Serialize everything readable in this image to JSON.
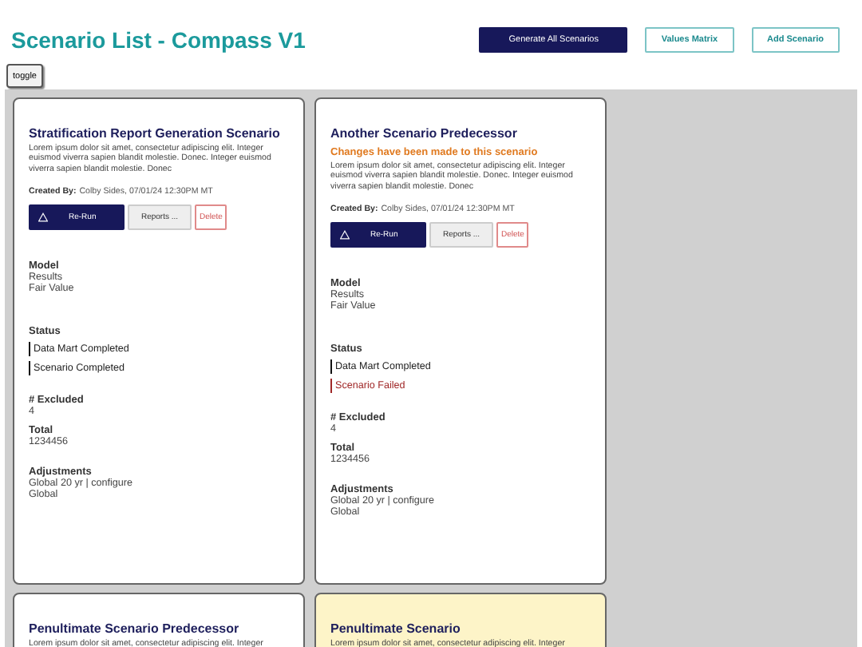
{
  "header": {
    "title": "Scenario List - Compass V1",
    "buttons": [
      {
        "label": "Generate All Scenarios",
        "kind": "primary"
      },
      {
        "label": "Values Matrix",
        "kind": "outline"
      },
      {
        "label": "Add Scenario",
        "kind": "outline"
      }
    ]
  },
  "toggle": "toggle",
  "cards": [
    {
      "title": "Stratification Report Generation Scenario",
      "highlighted": false,
      "description": "Lorem ipsum dolor sit amet, consectetur adipiscing elit. Integer euismod viverra sapien blandit molestie. Donec. Integer euismod viverra sapien blandit molestie. Donec",
      "created_label": "Created By:",
      "created_value": "Colby Sides, 07/01/24 12:30PM MT",
      "actions": {
        "rerun": "Re-Run",
        "reports": "Reports ...",
        "delete": "Delete"
      },
      "sections": [
        {
          "label": "Model",
          "values": [
            "Results",
            "Fair Value"
          ]
        }
      ],
      "status_label": "Status",
      "statuses": [
        {
          "text": "Data Mart Completed",
          "kind": "ok"
        },
        {
          "text": "Scenario Completed",
          "kind": "ok"
        }
      ],
      "details": [
        {
          "label": "# Excluded",
          "values": [
            "4"
          ]
        },
        {
          "label": "Total",
          "values": [
            "1234456"
          ]
        },
        {
          "label": "Adjustments",
          "values": [
            "Global 20 yr | configure",
            "Global"
          ]
        }
      ]
    },
    {
      "title": "Another Scenario Predecessor",
      "highlighted": false,
      "warning": "Changes have been made to this scenario",
      "description": "Lorem ipsum dolor sit amet, consectetur adipiscing elit. Integer euismod viverra sapien blandit molestie. Donec. Integer euismod viverra sapien blandit molestie. Donec",
      "created_label": "Created By:",
      "created_value": "Colby Sides, 07/01/24 12:30PM MT",
      "actions": {
        "rerun": "Re-Run",
        "reports": "Reports ...",
        "delete": "Delete"
      },
      "sections": [
        {
          "label": "Model",
          "values": [
            "Results",
            "Fair Value"
          ]
        }
      ],
      "status_label": "Status",
      "statuses": [
        {
          "text": "Data Mart Completed",
          "kind": "ok"
        },
        {
          "text": "Scenario Failed",
          "kind": "failed"
        }
      ],
      "details": [
        {
          "label": "# Excluded",
          "values": [
            "4"
          ]
        },
        {
          "label": "Total",
          "values": [
            "1234456"
          ]
        },
        {
          "label": "Adjustments",
          "values": [
            "Global 20 yr | configure",
            "Global"
          ]
        }
      ]
    },
    {
      "title": "Penultimate Scenario Predecessor",
      "highlighted": false,
      "description": "Lorem ipsum dolor sit amet, consectetur adipiscing elit. Integer"
    },
    {
      "title": "Penultimate Scenario",
      "highlighted": true,
      "description": "Lorem ipsum dolor sit amet, consectetur adipiscing elit. Integer"
    }
  ]
}
